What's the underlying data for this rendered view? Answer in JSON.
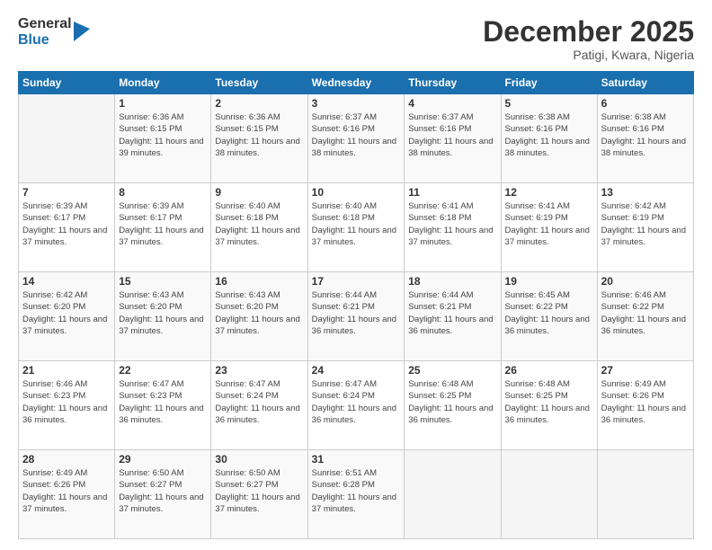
{
  "logo": {
    "general": "General",
    "blue": "Blue"
  },
  "title": "December 2025",
  "location": "Patigi, Kwara, Nigeria",
  "days_header": [
    "Sunday",
    "Monday",
    "Tuesday",
    "Wednesday",
    "Thursday",
    "Friday",
    "Saturday"
  ],
  "weeks": [
    [
      {
        "day": "",
        "sunrise": "",
        "sunset": "",
        "daylight": ""
      },
      {
        "day": "1",
        "sunrise": "Sunrise: 6:36 AM",
        "sunset": "Sunset: 6:15 PM",
        "daylight": "Daylight: 11 hours and 39 minutes."
      },
      {
        "day": "2",
        "sunrise": "Sunrise: 6:36 AM",
        "sunset": "Sunset: 6:15 PM",
        "daylight": "Daylight: 11 hours and 38 minutes."
      },
      {
        "day": "3",
        "sunrise": "Sunrise: 6:37 AM",
        "sunset": "Sunset: 6:16 PM",
        "daylight": "Daylight: 11 hours and 38 minutes."
      },
      {
        "day": "4",
        "sunrise": "Sunrise: 6:37 AM",
        "sunset": "Sunset: 6:16 PM",
        "daylight": "Daylight: 11 hours and 38 minutes."
      },
      {
        "day": "5",
        "sunrise": "Sunrise: 6:38 AM",
        "sunset": "Sunset: 6:16 PM",
        "daylight": "Daylight: 11 hours and 38 minutes."
      },
      {
        "day": "6",
        "sunrise": "Sunrise: 6:38 AM",
        "sunset": "Sunset: 6:16 PM",
        "daylight": "Daylight: 11 hours and 38 minutes."
      }
    ],
    [
      {
        "day": "7",
        "sunrise": "Sunrise: 6:39 AM",
        "sunset": "Sunset: 6:17 PM",
        "daylight": "Daylight: 11 hours and 37 minutes."
      },
      {
        "day": "8",
        "sunrise": "Sunrise: 6:39 AM",
        "sunset": "Sunset: 6:17 PM",
        "daylight": "Daylight: 11 hours and 37 minutes."
      },
      {
        "day": "9",
        "sunrise": "Sunrise: 6:40 AM",
        "sunset": "Sunset: 6:18 PM",
        "daylight": "Daylight: 11 hours and 37 minutes."
      },
      {
        "day": "10",
        "sunrise": "Sunrise: 6:40 AM",
        "sunset": "Sunset: 6:18 PM",
        "daylight": "Daylight: 11 hours and 37 minutes."
      },
      {
        "day": "11",
        "sunrise": "Sunrise: 6:41 AM",
        "sunset": "Sunset: 6:18 PM",
        "daylight": "Daylight: 11 hours and 37 minutes."
      },
      {
        "day": "12",
        "sunrise": "Sunrise: 6:41 AM",
        "sunset": "Sunset: 6:19 PM",
        "daylight": "Daylight: 11 hours and 37 minutes."
      },
      {
        "day": "13",
        "sunrise": "Sunrise: 6:42 AM",
        "sunset": "Sunset: 6:19 PM",
        "daylight": "Daylight: 11 hours and 37 minutes."
      }
    ],
    [
      {
        "day": "14",
        "sunrise": "Sunrise: 6:42 AM",
        "sunset": "Sunset: 6:20 PM",
        "daylight": "Daylight: 11 hours and 37 minutes."
      },
      {
        "day": "15",
        "sunrise": "Sunrise: 6:43 AM",
        "sunset": "Sunset: 6:20 PM",
        "daylight": "Daylight: 11 hours and 37 minutes."
      },
      {
        "day": "16",
        "sunrise": "Sunrise: 6:43 AM",
        "sunset": "Sunset: 6:20 PM",
        "daylight": "Daylight: 11 hours and 37 minutes."
      },
      {
        "day": "17",
        "sunrise": "Sunrise: 6:44 AM",
        "sunset": "Sunset: 6:21 PM",
        "daylight": "Daylight: 11 hours and 36 minutes."
      },
      {
        "day": "18",
        "sunrise": "Sunrise: 6:44 AM",
        "sunset": "Sunset: 6:21 PM",
        "daylight": "Daylight: 11 hours and 36 minutes."
      },
      {
        "day": "19",
        "sunrise": "Sunrise: 6:45 AM",
        "sunset": "Sunset: 6:22 PM",
        "daylight": "Daylight: 11 hours and 36 minutes."
      },
      {
        "day": "20",
        "sunrise": "Sunrise: 6:46 AM",
        "sunset": "Sunset: 6:22 PM",
        "daylight": "Daylight: 11 hours and 36 minutes."
      }
    ],
    [
      {
        "day": "21",
        "sunrise": "Sunrise: 6:46 AM",
        "sunset": "Sunset: 6:23 PM",
        "daylight": "Daylight: 11 hours and 36 minutes."
      },
      {
        "day": "22",
        "sunrise": "Sunrise: 6:47 AM",
        "sunset": "Sunset: 6:23 PM",
        "daylight": "Daylight: 11 hours and 36 minutes."
      },
      {
        "day": "23",
        "sunrise": "Sunrise: 6:47 AM",
        "sunset": "Sunset: 6:24 PM",
        "daylight": "Daylight: 11 hours and 36 minutes."
      },
      {
        "day": "24",
        "sunrise": "Sunrise: 6:47 AM",
        "sunset": "Sunset: 6:24 PM",
        "daylight": "Daylight: 11 hours and 36 minutes."
      },
      {
        "day": "25",
        "sunrise": "Sunrise: 6:48 AM",
        "sunset": "Sunset: 6:25 PM",
        "daylight": "Daylight: 11 hours and 36 minutes."
      },
      {
        "day": "26",
        "sunrise": "Sunrise: 6:48 AM",
        "sunset": "Sunset: 6:25 PM",
        "daylight": "Daylight: 11 hours and 36 minutes."
      },
      {
        "day": "27",
        "sunrise": "Sunrise: 6:49 AM",
        "sunset": "Sunset: 6:26 PM",
        "daylight": "Daylight: 11 hours and 36 minutes."
      }
    ],
    [
      {
        "day": "28",
        "sunrise": "Sunrise: 6:49 AM",
        "sunset": "Sunset: 6:26 PM",
        "daylight": "Daylight: 11 hours and 37 minutes."
      },
      {
        "day": "29",
        "sunrise": "Sunrise: 6:50 AM",
        "sunset": "Sunset: 6:27 PM",
        "daylight": "Daylight: 11 hours and 37 minutes."
      },
      {
        "day": "30",
        "sunrise": "Sunrise: 6:50 AM",
        "sunset": "Sunset: 6:27 PM",
        "daylight": "Daylight: 11 hours and 37 minutes."
      },
      {
        "day": "31",
        "sunrise": "Sunrise: 6:51 AM",
        "sunset": "Sunset: 6:28 PM",
        "daylight": "Daylight: 11 hours and 37 minutes."
      },
      {
        "day": "",
        "sunrise": "",
        "sunset": "",
        "daylight": ""
      },
      {
        "day": "",
        "sunrise": "",
        "sunset": "",
        "daylight": ""
      },
      {
        "day": "",
        "sunrise": "",
        "sunset": "",
        "daylight": ""
      }
    ]
  ]
}
